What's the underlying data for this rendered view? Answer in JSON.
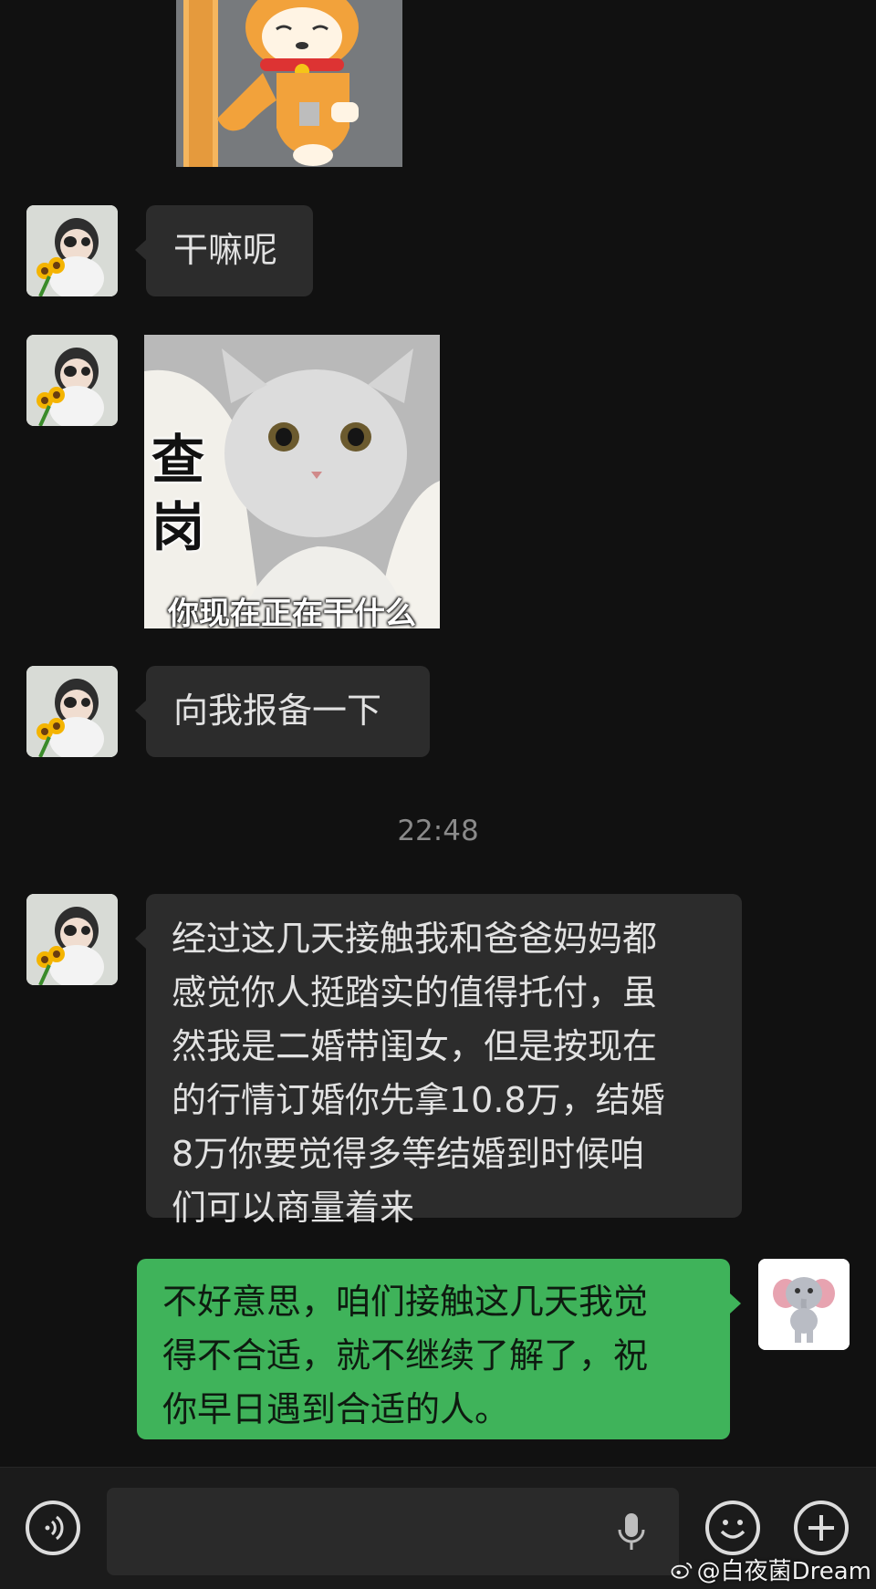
{
  "messages": [
    {
      "text": "干嘛呢"
    },
    {
      "sticker_caption_side": "查岗",
      "sticker_caption_bottom": "你现在正在干什么"
    },
    {
      "text": "向我报备一下"
    },
    {
      "timestamp": "22:48"
    },
    {
      "lines": [
        "经过这几天接触我和爸爸妈妈都",
        "感觉你人挺踏实的值得托付，虽",
        "然我是二婚带闺女，但是按现在",
        "的行情订婚你先拿10.8万，结婚",
        "8万你要觉得多等结婚到时候咱",
        "们可以商量着来"
      ]
    },
    {
      "lines": [
        "不好意思，咱们接触这几天我觉",
        "得不合适，就不继续了解了，祝",
        "你早日遇到合适的人。"
      ]
    }
  ],
  "watermark": "@白夜菌Dream",
  "icons": {
    "voice": "voice-toggle-icon",
    "mic": "microphone-icon",
    "emoji": "emoji-icon",
    "add": "plus-icon",
    "weibo": "weibo-logo-icon"
  },
  "colors": {
    "background": "#111111",
    "incoming_bubble": "#2c2c2c",
    "outgoing_bubble": "#3fb35a"
  }
}
